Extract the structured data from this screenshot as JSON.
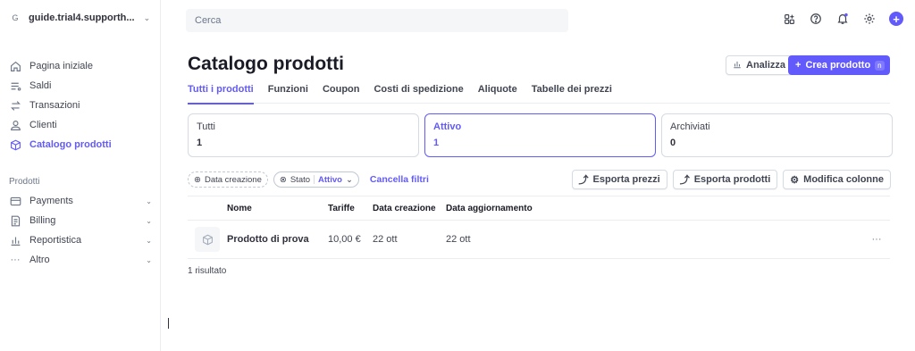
{
  "account": {
    "initial": "G",
    "name": "guide.trial4.supporth..."
  },
  "nav": [
    {
      "label": "Pagina iniziale",
      "icon": "home-icon"
    },
    {
      "label": "Saldi",
      "icon": "balance-icon"
    },
    {
      "label": "Transazioni",
      "icon": "arrows-icon"
    },
    {
      "label": "Clienti",
      "icon": "person-icon"
    },
    {
      "label": "Catalogo prodotti",
      "icon": "cube-icon",
      "active": true
    }
  ],
  "products_section": "Prodotti",
  "nav2": [
    {
      "label": "Payments",
      "icon": "card-icon"
    },
    {
      "label": "Billing",
      "icon": "invoice-icon"
    },
    {
      "label": "Reportistica",
      "icon": "chart-icon"
    },
    {
      "label": "Altro",
      "icon": "more-icon"
    }
  ],
  "search": {
    "placeholder": "Cerca"
  },
  "header": {
    "title": "Catalogo prodotti",
    "analizza": "Analizza",
    "create": "Crea prodotto",
    "create_shortcut": "n"
  },
  "tabs": [
    "Tutti i prodotti",
    "Funzioni",
    "Coupon",
    "Costi di spedizione",
    "Aliquote",
    "Tabelle dei prezzi"
  ],
  "cards": [
    {
      "label": "Tutti",
      "value": "1"
    },
    {
      "label": "Attivo",
      "value": "1"
    },
    {
      "label": "Archiviati",
      "value": "0"
    }
  ],
  "filters": {
    "date": "Data creazione",
    "status_label": "Stato",
    "status_value": "Attivo",
    "clear": "Cancella filtri"
  },
  "exports": {
    "prices": "Esporta prezzi",
    "products": "Esporta prodotti",
    "columns": "Modifica colonne"
  },
  "table": {
    "headers": [
      "Nome",
      "Tariffe",
      "Data creazione",
      "Data aggiornamento"
    ],
    "rows": [
      {
        "name": "Prodotto di prova",
        "price": "10,00 €",
        "created": "22 ott",
        "updated": "22 ott"
      }
    ]
  },
  "result_count": "1 risultato",
  "colors": {
    "accent": "#625afa",
    "text": "#30313d",
    "border": "#d5dbe1"
  }
}
